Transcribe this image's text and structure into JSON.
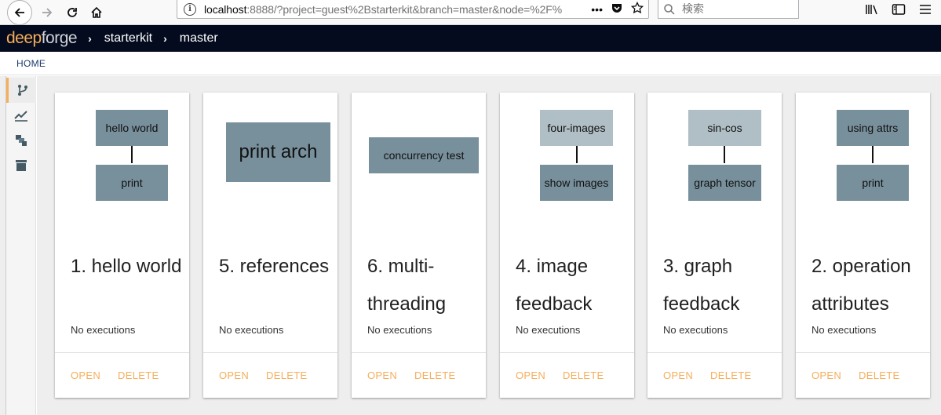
{
  "browser": {
    "url_host": "localhost",
    "url_rest": ":8888/?project=guest%2Bstarterkit&branch=master&node=%2F%",
    "url_menu": "•••",
    "search_placeholder": "検索"
  },
  "header": {
    "logo_deep": "deep",
    "logo_forge": "forge",
    "breadcrumbs": [
      "starterkit",
      "master"
    ]
  },
  "home_label": "HOME",
  "cards": [
    {
      "title": "1. hello world",
      "subtitle": "No executions",
      "open": "OPEN",
      "delete": "DELETE",
      "nodes": [
        "hello world",
        "print"
      ]
    },
    {
      "title": "5. references",
      "subtitle": "No executions",
      "open": "OPEN",
      "delete": "DELETE",
      "nodes": [
        "print arch"
      ]
    },
    {
      "title": "6. multi-threading",
      "subtitle": "No executions",
      "open": "OPEN",
      "delete": "DELETE",
      "nodes": [
        "concurrency test"
      ]
    },
    {
      "title": "4. image feedback",
      "subtitle": "No executions",
      "open": "OPEN",
      "delete": "DELETE",
      "nodes": [
        "four-images",
        "show images"
      ]
    },
    {
      "title": "3. graph feedback",
      "subtitle": "No executions",
      "open": "OPEN",
      "delete": "DELETE",
      "nodes": [
        "sin-cos",
        "graph tensor"
      ]
    },
    {
      "title": "2. operation attributes",
      "subtitle": "No executions",
      "open": "OPEN",
      "delete": "DELETE",
      "nodes": [
        "using attrs",
        "print"
      ]
    }
  ]
}
